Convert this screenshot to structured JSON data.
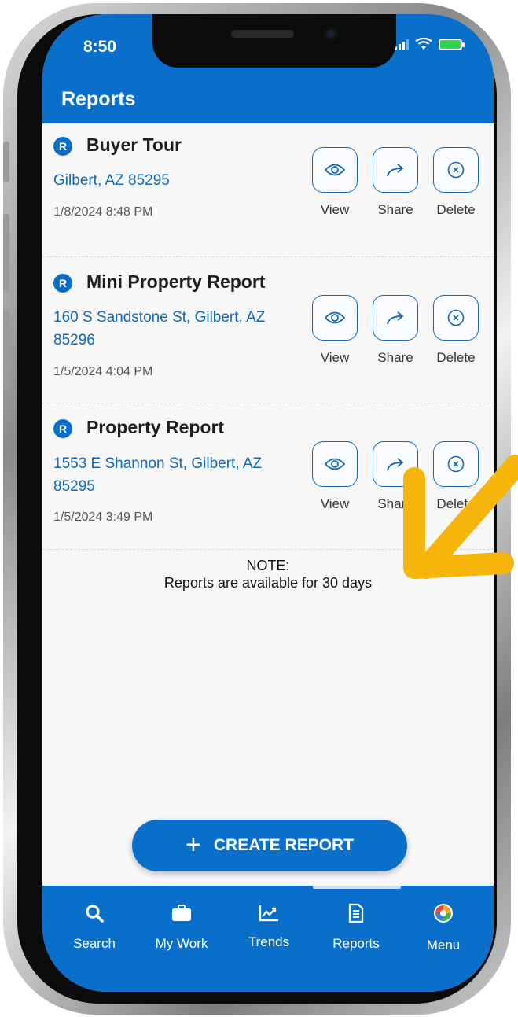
{
  "status_bar": {
    "time": "8:50"
  },
  "header": {
    "title": "Reports"
  },
  "reports": [
    {
      "badge": "R",
      "title": "Buyer Tour",
      "address": "Gilbert, AZ 85295",
      "date": "1/8/2024 8:48 PM"
    },
    {
      "badge": "R",
      "title": "Mini Property Report",
      "address": "160 S Sandstone St, Gilbert, AZ 85296",
      "date": "1/5/2024 4:04 PM"
    },
    {
      "badge": "R",
      "title": "Property Report",
      "address": "1553 E Shannon St, Gilbert, AZ 85295",
      "date": "1/5/2024 3:49 PM"
    }
  ],
  "actions": {
    "view": "View",
    "share": "Share",
    "delete": "Delete"
  },
  "note": {
    "line1": "NOTE:",
    "line2": "Reports are available for 30 days"
  },
  "create_button": {
    "label": "CREATE REPORT"
  },
  "tabs": [
    {
      "label": "Search",
      "icon": "search-icon"
    },
    {
      "label": "My Work",
      "icon": "briefcase-icon"
    },
    {
      "label": "Trends",
      "icon": "trend-chart-icon"
    },
    {
      "label": "Reports",
      "icon": "report-document-icon"
    },
    {
      "label": "Menu",
      "icon": "menu-logo-icon"
    }
  ],
  "colors": {
    "primary": "#0a6ecb",
    "link": "#1268b5",
    "annotation_arrow": "#f5b50a"
  }
}
